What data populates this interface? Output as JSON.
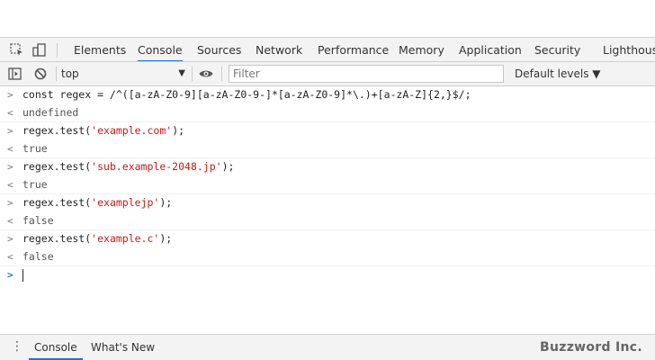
{
  "tabs": [
    "Elements",
    "Console",
    "Sources",
    "Network",
    "Performance",
    "Memory",
    "Application",
    "Security",
    "Lighthouse"
  ],
  "toolbar": {
    "context": "top",
    "filter_placeholder": "Filter",
    "levels": "Default levels ▼"
  },
  "console": {
    "lines": [
      {
        "kind": "input",
        "parts": [
          {
            "t": "const regex = /^([a-zA-Z0-9][a-zA-Z0-9-]*[a-zA-Z0-9]*\\.)+[a-zA-Z]{2,}$/;",
            "c": "op"
          }
        ]
      },
      {
        "kind": "output",
        "text": "undefined"
      },
      {
        "kind": "input",
        "parts": [
          {
            "t": "regex.test(",
            "c": "op"
          },
          {
            "t": "'example.com'",
            "c": "str"
          },
          {
            "t": ");",
            "c": "op"
          }
        ]
      },
      {
        "kind": "output",
        "text": "true"
      },
      {
        "kind": "input",
        "parts": [
          {
            "t": "regex.test(",
            "c": "op"
          },
          {
            "t": "'sub.example-2048.jp'",
            "c": "str"
          },
          {
            "t": ");",
            "c": "op"
          }
        ]
      },
      {
        "kind": "output",
        "text": "true"
      },
      {
        "kind": "input",
        "parts": [
          {
            "t": "regex.test(",
            "c": "op"
          },
          {
            "t": "'examplejp'",
            "c": "str"
          },
          {
            "t": ");",
            "c": "op"
          }
        ]
      },
      {
        "kind": "output",
        "text": "false"
      },
      {
        "kind": "input",
        "parts": [
          {
            "t": "regex.test(",
            "c": "op"
          },
          {
            "t": "'example.c'",
            "c": "str"
          },
          {
            "t": ");",
            "c": "op"
          }
        ]
      },
      {
        "kind": "output",
        "text": "false"
      }
    ]
  },
  "drawer": {
    "tab_console": "Console",
    "tab_whats_new": "What's New",
    "brand": "Buzzword Inc."
  }
}
